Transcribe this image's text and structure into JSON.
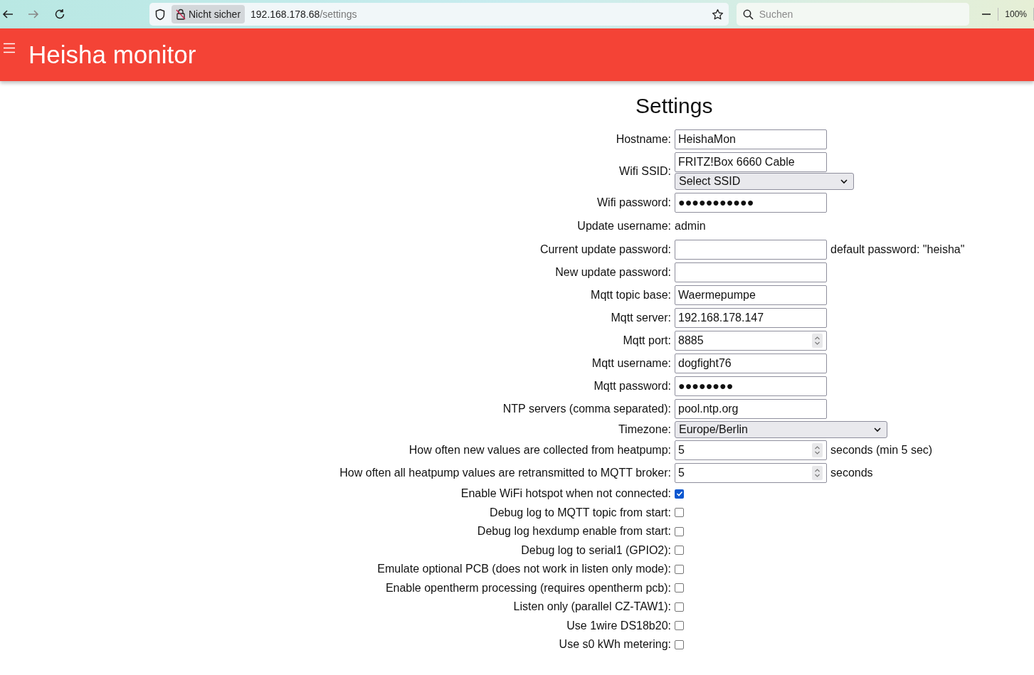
{
  "browser": {
    "security_label": "Nicht sicher",
    "url_host": "192.168.178.68",
    "url_path": "/settings",
    "search_placeholder": "Suchen",
    "zoom_level": "100%"
  },
  "header": {
    "title": "Heisha monitor"
  },
  "page_title": "Settings",
  "fields": [
    {
      "kind": "text",
      "label": "Hostname:",
      "value": "HeishaMon"
    },
    {
      "kind": "ssid",
      "label": "Wifi SSID:",
      "value": "FRITZ!Box 6660 Cable",
      "select_value": "Select SSID"
    },
    {
      "kind": "text",
      "label": "Wifi password:",
      "value": "●●●●●●●●●●●"
    },
    {
      "kind": "static",
      "label": "Update username:",
      "value": "admin"
    },
    {
      "kind": "text",
      "label": "Current update password:",
      "note": "default password: \"heisha\""
    },
    {
      "kind": "text",
      "label": "New update password:"
    },
    {
      "kind": "text",
      "label": "Mqtt topic base:",
      "value": "Waermepumpe"
    },
    {
      "kind": "text",
      "label": "Mqtt server:",
      "value": "192.168.178.147"
    },
    {
      "kind": "number",
      "label": "Mqtt port:",
      "value": "8885"
    },
    {
      "kind": "text",
      "label": "Mqtt username:",
      "value": "dogfight76"
    },
    {
      "kind": "text",
      "label": "Mqtt password:",
      "value": "●●●●●●●●"
    },
    {
      "kind": "text",
      "label": "NTP servers (comma separated):",
      "value": "pool.ntp.org"
    },
    {
      "kind": "select",
      "label": "Timezone:",
      "value": "Europe/Berlin"
    },
    {
      "kind": "number",
      "label": "How often new values are collected from heatpump:",
      "value": "5",
      "note": "seconds (min 5 sec)"
    },
    {
      "kind": "number",
      "label": "How often all heatpump values are retransmitted to MQTT broker:",
      "value": "5",
      "note": "seconds"
    },
    {
      "kind": "checkbox",
      "label": "Enable WiFi hotspot when not connected:",
      "checked": true
    },
    {
      "kind": "checkbox",
      "label": "Debug log to MQTT topic from start:",
      "checked": false
    },
    {
      "kind": "checkbox",
      "label": "Debug log hexdump enable from start:",
      "checked": false
    },
    {
      "kind": "checkbox",
      "label": "Debug log to serial1 (GPIO2):",
      "checked": false
    },
    {
      "kind": "checkbox",
      "label": "Emulate optional PCB (does not work in listen only mode):",
      "checked": false
    },
    {
      "kind": "checkbox",
      "label": "Enable opentherm processing (requires opentherm pcb):",
      "checked": false
    },
    {
      "kind": "checkbox",
      "label": "Listen only (parallel CZ-TAW1):",
      "checked": false
    },
    {
      "kind": "checkbox",
      "label": "Use 1wire DS18b20:",
      "checked": false
    },
    {
      "kind": "checkbox",
      "label": "Use s0 kWh metering:",
      "checked": false
    }
  ]
}
